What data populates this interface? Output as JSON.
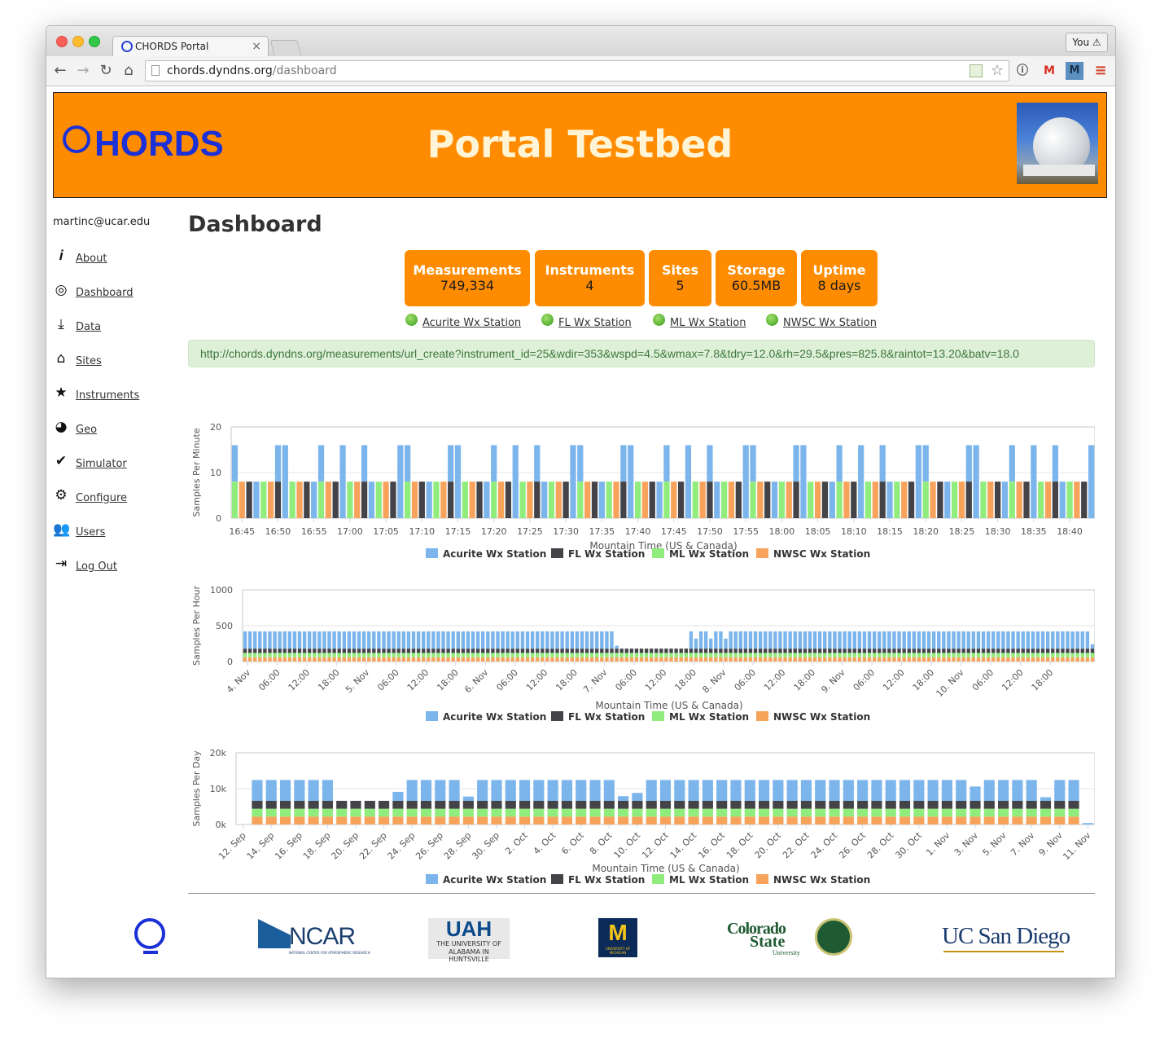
{
  "browser": {
    "tab_title": "CHORDS Portal",
    "tab_close": "×",
    "profile_label": "You ⚠",
    "url_host": "chords.dyndns.org",
    "url_path": "/dashboard",
    "back_icon": "arrow-left-icon",
    "forward_icon": "arrow-right-icon",
    "reload_icon": "reload-icon",
    "home_icon": "home-icon",
    "bookmark_icon": "star-outline-icon"
  },
  "banner": {
    "logo_text": "HORDS",
    "title": "Portal Testbed"
  },
  "sidebar": {
    "user": "martinc@ucar.edu",
    "items": [
      {
        "label": "About",
        "icon": "info-icon",
        "glyph": "𝒊"
      },
      {
        "label": "Dashboard",
        "icon": "target-icon",
        "glyph": "◎"
      },
      {
        "label": "Data",
        "icon": "download-icon",
        "glyph": "⤓"
      },
      {
        "label": "Sites",
        "icon": "home-icon",
        "glyph": "⌂"
      },
      {
        "label": "Instruments",
        "icon": "star-icon",
        "glyph": "★"
      },
      {
        "label": "Geo",
        "icon": "globe-icon",
        "glyph": "◕"
      },
      {
        "label": "Simulator",
        "icon": "check-icon",
        "glyph": "✔"
      },
      {
        "label": "Configure",
        "icon": "gear-icon",
        "glyph": "⚙"
      },
      {
        "label": "Users",
        "icon": "users-icon",
        "glyph": "👥"
      },
      {
        "label": "Log Out",
        "icon": "logout-icon",
        "glyph": "⇥"
      }
    ]
  },
  "main": {
    "heading": "Dashboard",
    "stats": [
      {
        "label": "Measurements",
        "value": "749,334"
      },
      {
        "label": "Instruments",
        "value": "4"
      },
      {
        "label": "Sites",
        "value": "5"
      },
      {
        "label": "Storage",
        "value": "60.5MB"
      },
      {
        "label": "Uptime",
        "value": "8 days"
      }
    ],
    "stations": [
      "Acurite Wx Station",
      "FL Wx Station",
      "ML Wx Station",
      "NWSC Wx Station"
    ],
    "url_text": "http://chords.dyndns.org/measurements/url_create?instrument_id=25&wdir=353&wspd=4.5&wmax=7.8&tdry=12.0&rh=29.5&pres=825.8&raintot=13.20&batv=18.0"
  },
  "colors": {
    "orange": "#ff8c00",
    "acurite": "#7cb5ec",
    "fl": "#434348",
    "ml": "#90ed7d",
    "nwsc": "#f7a35c"
  },
  "chart_data": [
    {
      "type": "bar",
      "stacked": false,
      "ylabel": "Samples Per Minute",
      "xlabel": "Mountain Time (US & Canada)",
      "ylim": [
        0,
        20
      ],
      "yticks": [
        "0",
        "10",
        "20"
      ],
      "xticks": [
        "16:45",
        "16:50",
        "16:55",
        "17:00",
        "17:05",
        "17:10",
        "17:15",
        "17:20",
        "17:25",
        "17:30",
        "17:35",
        "17:40",
        "17:45",
        "17:50",
        "17:55",
        "18:00",
        "18:05",
        "18:10",
        "18:15",
        "18:20",
        "18:25",
        "18:30",
        "18:35",
        "18:40"
      ],
      "x_start": "16:44",
      "x_end": "18:43",
      "series_names": [
        "Acurite Wx Station",
        "FL Wx Station",
        "ML Wx Station",
        "NWSC Wx Station"
      ],
      "series": [
        {
          "name": "Acurite Wx Station",
          "pattern": "16 every 2 min, alternating with 8"
        },
        {
          "name": "FL Wx Station",
          "value": 8
        },
        {
          "name": "ML Wx Station",
          "value": 8
        },
        {
          "name": "NWSC Wx Station",
          "value": 8
        }
      ],
      "grid": true,
      "legend": "bottom-center"
    },
    {
      "type": "bar",
      "stacked": true,
      "ylabel": "Samples Per Hour",
      "xlabel": "Mountain Time (US & Canada)",
      "ylim": [
        0,
        1000
      ],
      "yticks": [
        "0",
        "500",
        "1000"
      ],
      "xticks": [
        "4. Nov",
        "06:00",
        "12:00",
        "18:00",
        "5. Nov",
        "06:00",
        "12:00",
        "18:00",
        "6. Nov",
        "06:00",
        "12:00",
        "18:00",
        "7. Nov",
        "06:00",
        "12:00",
        "18:00",
        "8. Nov",
        "06:00",
        "12:00",
        "18:00",
        "9. Nov",
        "06:00",
        "12:00",
        "18:00",
        "10. Nov",
        "06:00",
        "12:00",
        "18:00"
      ],
      "series": [
        {
          "name": "NWSC Wx Station",
          "typical": 60
        },
        {
          "name": "ML Wx Station",
          "typical": 60
        },
        {
          "name": "FL Wx Station",
          "typical": 60
        },
        {
          "name": "Acurite Wx Station",
          "typical": 240
        }
      ],
      "grid": true,
      "legend": "bottom-center"
    },
    {
      "type": "bar",
      "stacked": true,
      "ylabel": "Samples Per Day",
      "xlabel": "Mountain Time (US & Canada)",
      "ylim": [
        0,
        20000
      ],
      "yticks": [
        "0k",
        "10k",
        "20k"
      ],
      "xticks": [
        "12. Sep",
        "14. Sep",
        "16. Sep",
        "18. Sep",
        "20. Sep",
        "22. Sep",
        "24. Sep",
        "26. Sep",
        "28. Sep",
        "30. Sep",
        "2. Oct",
        "4. Oct",
        "6. Oct",
        "8. Oct",
        "10. Oct",
        "12. Oct",
        "14. Oct",
        "16. Oct",
        "18. Oct",
        "20. Oct",
        "22. Oct",
        "24. Oct",
        "26. Oct",
        "28. Oct",
        "30. Oct",
        "1. Nov",
        "3. Nov",
        "5. Nov",
        "7. Nov",
        "9. Nov",
        "11. Nov"
      ],
      "series": [
        {
          "name": "NWSC Wx Station",
          "typical": 2200
        },
        {
          "name": "ML Wx Station",
          "typical": 2200
        },
        {
          "name": "FL Wx Station",
          "typical": 2200
        },
        {
          "name": "Acurite Wx Station",
          "typical": 5800
        }
      ],
      "grid": true,
      "legend": "bottom-center"
    }
  ],
  "footer": {
    "logos": [
      {
        "name": "chords-globe-logo"
      },
      {
        "name": "ncar-logo",
        "text": "NCAR",
        "sub": "NATIONAL CENTER FOR ATMOSPHERIC RESEARCH"
      },
      {
        "name": "uah-logo",
        "text": "UAH",
        "sub1": "THE UNIVERSITY OF",
        "sub2": "ALABAMA IN HUNTSVILLE"
      },
      {
        "name": "michigan-logo",
        "text": "M",
        "sub": "UNIVERSITY OF MICHIGAN"
      },
      {
        "name": "csu-logo",
        "text1": "Colorado",
        "text2": "State",
        "sub": "University"
      },
      {
        "name": "ucsd-logo",
        "text": "UC San Diego"
      }
    ]
  }
}
